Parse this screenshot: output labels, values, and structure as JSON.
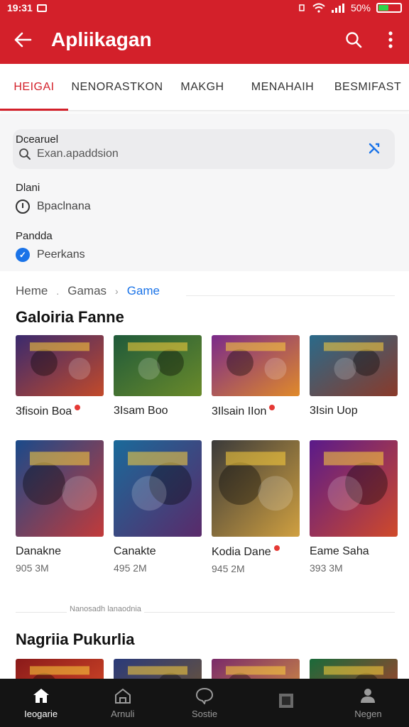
{
  "status": {
    "time": "19:31",
    "battery": "50%",
    "battery_level": 0.5,
    "battery_color": "#2fd44a"
  },
  "appbar": {
    "title": "Apliikagan",
    "color": "#d3202a"
  },
  "tabs": [
    {
      "label": "HEIGAI",
      "active": true
    },
    {
      "label": "NENORASTKON",
      "active": false
    },
    {
      "label": "MAKGH",
      "active": false
    },
    {
      "label": "MENAHAIH",
      "active": false
    },
    {
      "label": "BESMIFAST",
      "active": false
    }
  ],
  "filters": {
    "search": {
      "label": "Dcearuel",
      "placeholder": "Exan.apaddsion"
    },
    "group1": {
      "label": "Dlani",
      "value": "Bpaclnana"
    },
    "group2": {
      "label": "Pandda",
      "value": "Peerkans"
    }
  },
  "breadcrumb": {
    "home": "Heme",
    "games": "Gamas",
    "current": "Game"
  },
  "section1": {
    "title": "Galoiria Fanne",
    "row1": [
      {
        "name": "3fisoin Boa",
        "dot": true,
        "icon": "game-thumbnail-icon",
        "c1": "#3a2a6e",
        "c2": "#c24a2a"
      },
      {
        "name": "3Isam Boo",
        "dot": false,
        "icon": "game-thumbnail-icon",
        "c1": "#1f5a3a",
        "c2": "#6a8a2a"
      },
      {
        "name": "3Ilsain IIon",
        "dot": true,
        "icon": "game-thumbnail-icon",
        "c1": "#7a2a8a",
        "c2": "#e08a2a"
      },
      {
        "name": "3Isin Uop",
        "dot": false,
        "icon": "game-thumbnail-icon",
        "c1": "#2a6a8a",
        "c2": "#8a3a2a"
      }
    ],
    "row2": [
      {
        "name": "Danakne",
        "size": "905 3M",
        "dot": false,
        "c1": "#1a4a8a",
        "c2": "#c23a3a"
      },
      {
        "name": "Canakte",
        "size": "495 2M",
        "dot": false,
        "c1": "#1a6a9a",
        "c2": "#5a2a6a"
      },
      {
        "name": "Kodia Dane",
        "size": "945 2M",
        "dot": true,
        "c1": "#3a3a3a",
        "c2": "#d0a040"
      },
      {
        "name": "Eame Saha",
        "size": "393 3M",
        "dot": false,
        "c1": "#5a1a8a",
        "c2": "#d04a2a"
      }
    ]
  },
  "divider_label": "Nanosadh lanaodnia",
  "section2": {
    "title": "Nagriia Pukurlia",
    "row": [
      {
        "c1": "#8a1a1a",
        "c2": "#e0502a"
      },
      {
        "c1": "#2a3a7a",
        "c2": "#7a5a2a"
      },
      {
        "c1": "#7a2a6a",
        "c2": "#e0a03a"
      },
      {
        "c1": "#1a6a3a",
        "c2": "#c03a2a"
      }
    ]
  },
  "bottom_nav": [
    {
      "label": "Ieogarie",
      "icon": "home-icon",
      "active": true
    },
    {
      "label": "Arnuli",
      "icon": "store-icon",
      "active": false
    },
    {
      "label": "Sostie",
      "icon": "chat-icon",
      "active": false
    },
    {
      "label": "",
      "icon": "grid-icon",
      "active": false
    },
    {
      "label": "Negen",
      "icon": "profile-icon",
      "active": false
    }
  ]
}
